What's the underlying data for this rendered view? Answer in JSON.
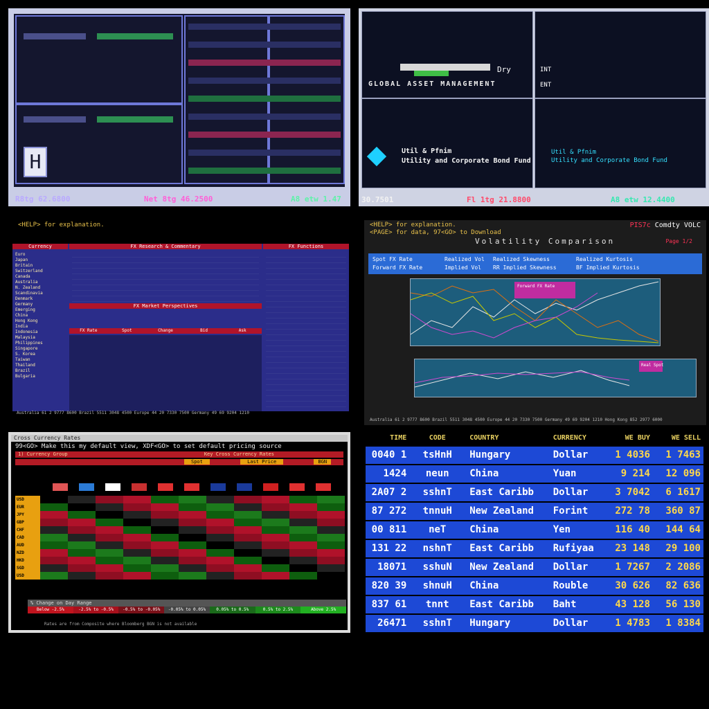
{
  "panel1": {
    "tickers": [
      {
        "text": "R8tg 62.6800",
        "color": "#b9a9ff"
      },
      {
        "text": "Net 8tg 46.2500",
        "color": "#ff5fd7"
      },
      {
        "text": "A8 etw 1.47",
        "color": "#5df2a8"
      }
    ],
    "logo_letter": "H"
  },
  "panel2": {
    "company": "GLOBAL ASSET MANAGEMENT",
    "fund_lines": [
      "Util & Pfnim",
      "Utility and Corporate Bond Fund"
    ],
    "fund_lines_alt": [
      "Util & Pfnim",
      "Utility and Corporate Bond Fund"
    ],
    "tickers": [
      {
        "text": "30.7501",
        "color": "#f2f2f2"
      },
      {
        "text": "Fl 1tg 21.8800",
        "color": "#ff4a6a"
      },
      {
        "text": "A8 etw 12.4400",
        "color": "#35e8b0"
      }
    ],
    "labels": [
      "Dry",
      "INT",
      "ENT"
    ]
  },
  "panel3": {
    "help": "<HELP> for explanation.",
    "headers": [
      "Currency",
      "FX Research & Commentary",
      "FX Functions",
      "FX Market Perspectives"
    ],
    "countries": [
      "Euro",
      "Japan",
      "Britain",
      "Switzerland",
      "Canada",
      "Australia",
      "N. Zealand",
      "Scandinavia",
      "Denmark",
      "Germany",
      "Emerging",
      "China",
      "Hong Kong",
      "India",
      "Indonesia",
      "Malaysia",
      "Philippines",
      "Singapore",
      "S. Korea",
      "Taiwan",
      "Thailand",
      "Brazil",
      "Bulgaria"
    ],
    "table_headers": [
      "FX Rate",
      "Spot",
      "Change",
      "Bid",
      "Ask"
    ],
    "footer": "Australia 61 2 9777 8600  Brazil 5511 3048 4500  Europe 44 20 7330 7500  Germany 49 69 9204 1210"
  },
  "panel4": {
    "help1": "<HELP> for explanation.",
    "help2": "<PAGE> for data, 97<GO> to Download",
    "code": "PIS7c",
    "code_name": "Comdty VOLC",
    "title": "Volatility Comparison",
    "page": "Page 1/2",
    "options_left": [
      "Spot FX Rate",
      "Forward FX Rate"
    ],
    "options_mid": [
      "Realized Vol",
      "Implied Vol"
    ],
    "options_right": [
      "Realized Skewness",
      "RR Implied Skewness",
      "Realized Kurtosis",
      "BF Implied Kurtosis"
    ],
    "upper_legend": "Forward FX Rate",
    "lower_legend": "Real Spot",
    "footer": "Australia 61 2 9777 8600 Brazil 5511 3048 4500 Europe 44 20 7330 7500 Germany 49 69 9204 1210 Hong Kong 852 2977 6000"
  },
  "panel5": {
    "window_title": "Cross Currency Rates",
    "help": "99<GO> Make this my default view, XDF<GO> to set default pricing source",
    "header": "1) Currency Group",
    "header_right": "Key Cross Currency Rates",
    "dropdowns": [
      "Spot",
      "Last Price",
      "BGN"
    ],
    "row_labels": [
      "USD",
      "EUR",
      "JPY",
      "GBP",
      "CHF",
      "CAD",
      "AUD",
      "NZD",
      "HKD",
      "SGD",
      "USD"
    ],
    "legend_title": "% Change on Day Range",
    "legend": [
      "Below -2.5%",
      "-2.5% to -0.5%",
      "-0.5% to -0.05%",
      "-0.05% to 0.05%",
      "0.05% to 0.5%",
      "0.5% to 2.5%",
      "Above 2.5%"
    ],
    "note": "Rates are from Composite where Bloomberg BGN is not available"
  },
  "panel6": {
    "headers": [
      "TIME",
      "CODE",
      "COUNTRY",
      "CURRENCY",
      "WE BUY",
      "WE SELL"
    ],
    "rows": [
      [
        "0040 1",
        "tsHnH",
        "Hungary",
        "Dollar",
        "1 4036",
        "1 7463"
      ],
      [
        "1424",
        "neun",
        "China",
        "Yuan",
        "9 214",
        "12 096"
      ],
      [
        "2A07 2",
        "sshnT",
        "East Caribb",
        "Dollar",
        "3 7042",
        "6 1617"
      ],
      [
        "87 272",
        "tnnuH",
        "New Zealand",
        "Forint",
        "272 78",
        "360 87"
      ],
      [
        "00 811",
        "neT",
        "China",
        "Yen",
        "116 40",
        "144 64"
      ],
      [
        "131 22",
        "nshnT",
        "East Caribb",
        "Rufiyaa",
        "23 148",
        "29 100"
      ],
      [
        "18071",
        "sshuN",
        "New Zealand",
        "Dollar",
        "1 7267",
        "2 2086"
      ],
      [
        "820 39",
        "shnuH",
        "China",
        "Rouble",
        "30 626",
        "82 636"
      ],
      [
        "837 61",
        "tnnt",
        "East Caribb",
        "Baht",
        "43 128",
        "56 130"
      ],
      [
        "26471",
        "sshnT",
        "Hungary",
        "Dollar",
        "1 4783",
        "1 8384"
      ]
    ]
  }
}
